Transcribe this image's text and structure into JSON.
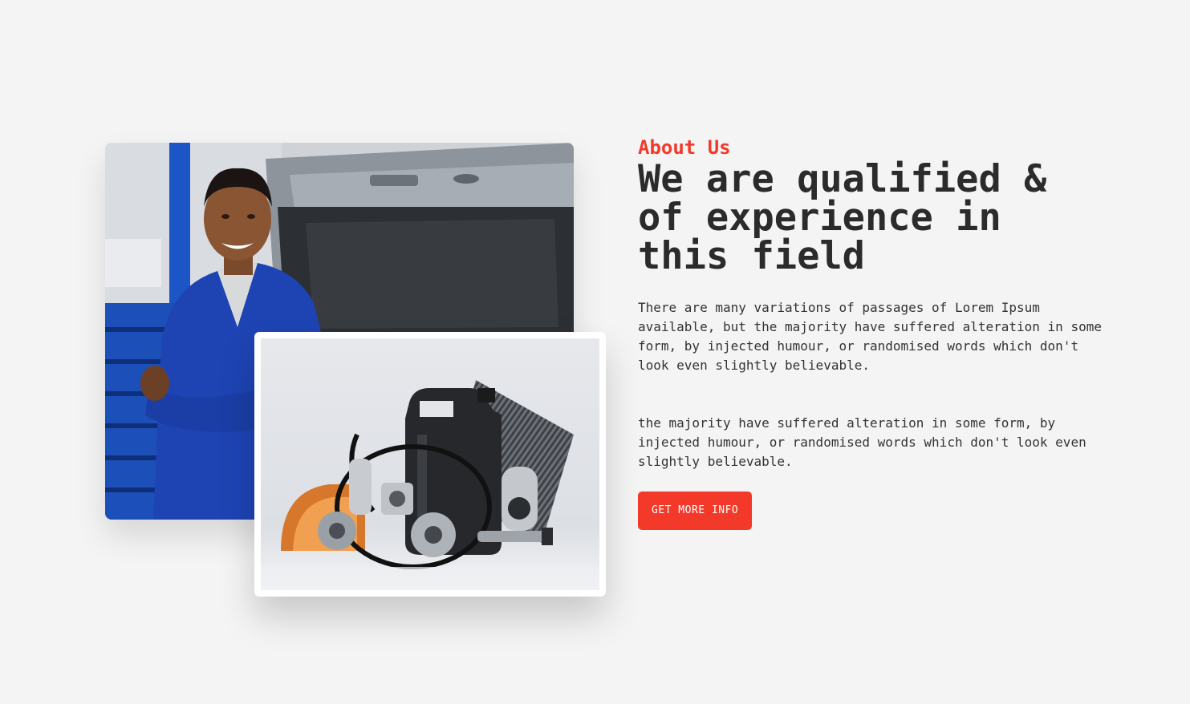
{
  "about": {
    "eyebrow": "About Us",
    "heading": "We are qualified & of experience in this field",
    "paragraph_1": "There are many variations of passages of Lorem Ipsum available, but the majority have suffered alteration in some form, by injected humour, or randomised words which don't look even slightly believable.",
    "paragraph_2": "the majority have suffered alteration in some form, by injected humour, or randomised words which don't look even slightly believable.",
    "cta_label": "GET MORE INFO"
  },
  "colors": {
    "accent": "#f2392a",
    "heading": "#2b2b2b",
    "body_text": "#333333",
    "background": "#f4f4f4"
  },
  "images": {
    "main": "mechanic-photo",
    "secondary": "car-parts-photo"
  }
}
